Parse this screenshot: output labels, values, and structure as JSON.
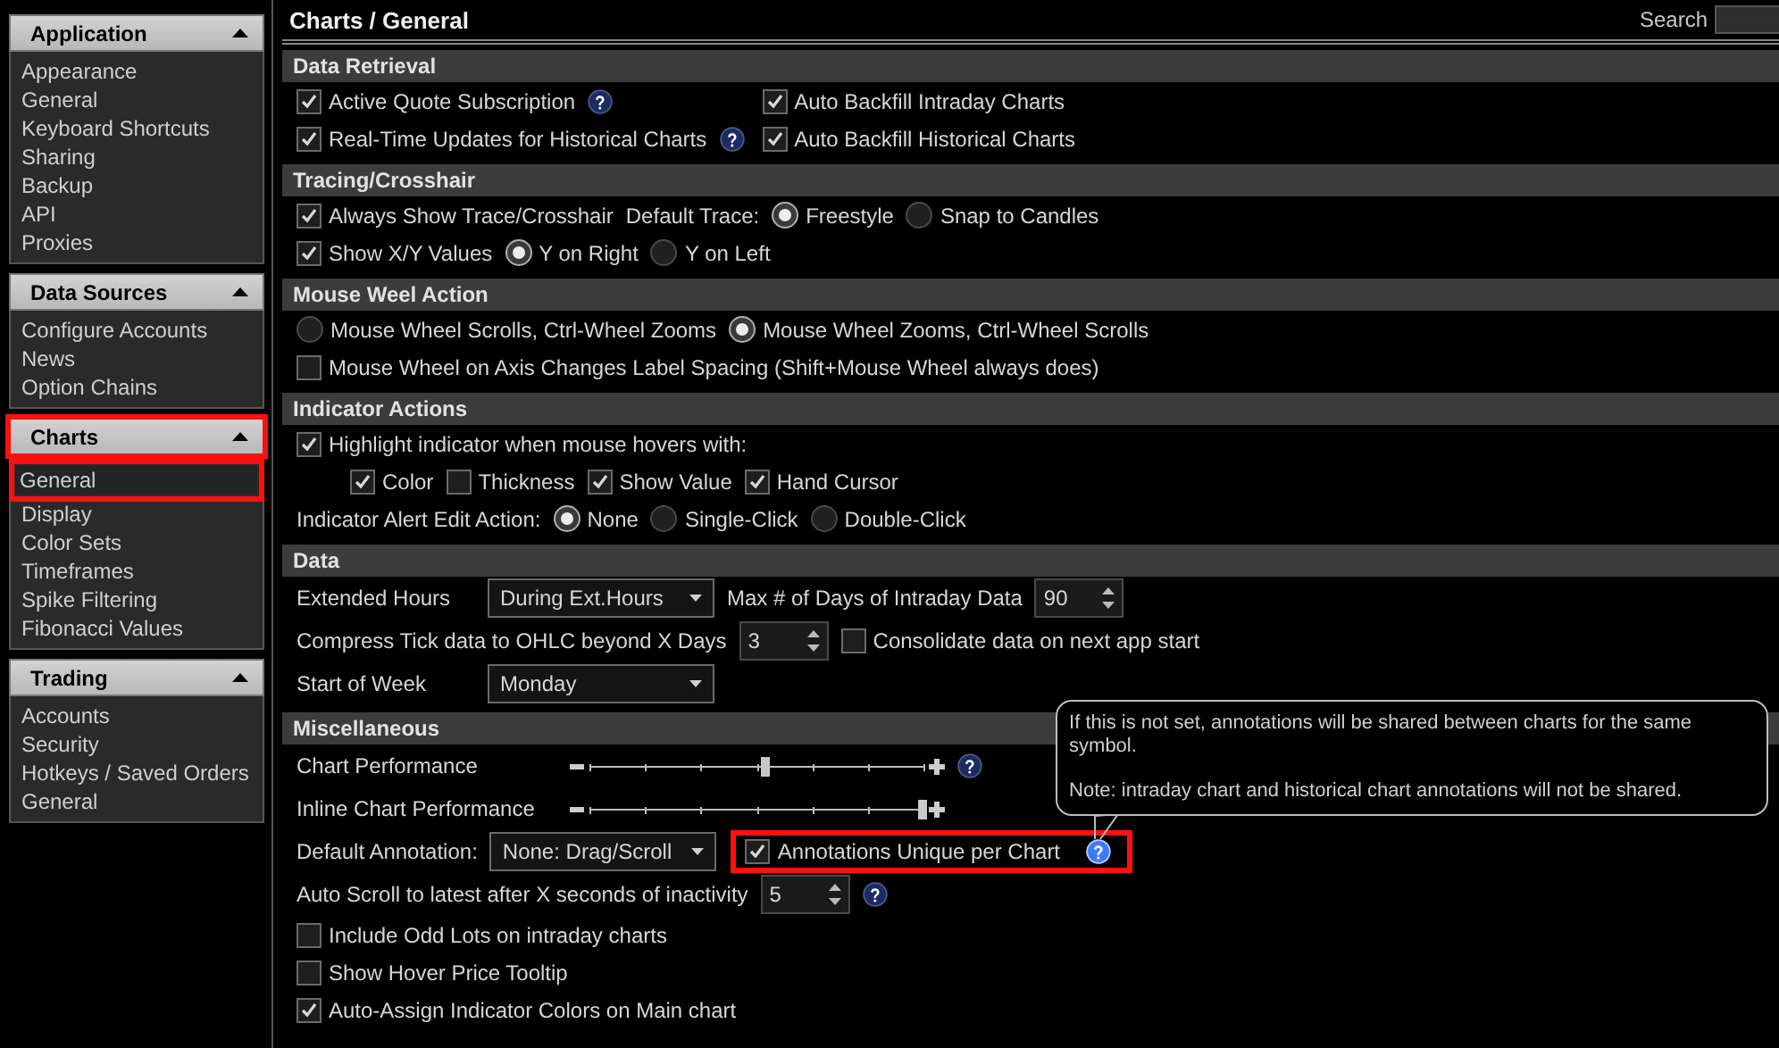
{
  "sidebar": {
    "groups": [
      {
        "title": "Application",
        "expanded": true,
        "highlighted": false,
        "items": [
          {
            "label": "Appearance",
            "selected": false
          },
          {
            "label": "General",
            "selected": false
          },
          {
            "label": "Keyboard Shortcuts",
            "selected": false
          },
          {
            "label": "Sharing",
            "selected": false
          },
          {
            "label": "Backup",
            "selected": false
          },
          {
            "label": "API",
            "selected": false
          },
          {
            "label": "Proxies",
            "selected": false
          }
        ]
      },
      {
        "title": "Data Sources",
        "expanded": true,
        "highlighted": false,
        "items": [
          {
            "label": "Configure Accounts",
            "selected": false
          },
          {
            "label": "News",
            "selected": false
          },
          {
            "label": "Option Chains",
            "selected": false
          }
        ]
      },
      {
        "title": "Charts",
        "expanded": true,
        "highlighted": true,
        "items": [
          {
            "label": "General",
            "selected": true
          },
          {
            "label": "Display",
            "selected": false
          },
          {
            "label": "Color Sets",
            "selected": false
          },
          {
            "label": "Timeframes",
            "selected": false
          },
          {
            "label": "Spike Filtering",
            "selected": false
          },
          {
            "label": "Fibonacci Values",
            "selected": false
          }
        ]
      },
      {
        "title": "Trading",
        "expanded": true,
        "highlighted": false,
        "items": [
          {
            "label": "Accounts",
            "selected": false
          },
          {
            "label": "Security",
            "selected": false
          },
          {
            "label": "Hotkeys / Saved Orders",
            "selected": false
          },
          {
            "label": "General",
            "selected": false
          }
        ]
      }
    ]
  },
  "page_title": "Charts / General",
  "search": {
    "label": "Search"
  },
  "sections": [
    {
      "title": "Data Retrieval",
      "kind": "grid",
      "rows": [
        {
          "cells": [
            [
              {
                "kind": "checkbox",
                "label": "Active Quote Subscription",
                "checked": true
              },
              {
                "kind": "help",
                "hovered": false
              }
            ],
            [
              {
                "kind": "checkbox",
                "label": "Auto Backfill Intraday Charts",
                "checked": true
              }
            ]
          ]
        },
        {
          "cells": [
            [
              {
                "kind": "checkbox",
                "label": "Real-Time Updates for Historical Charts",
                "checked": true
              },
              {
                "kind": "help",
                "hovered": false
              }
            ],
            [
              {
                "kind": "checkbox",
                "label": "Auto Backfill Historical Charts",
                "checked": true
              }
            ]
          ]
        }
      ]
    },
    {
      "title": "Tracing/Crosshair",
      "kind": "flow",
      "rows": [
        {
          "items": [
            {
              "kind": "checkbox",
              "label": "Always Show Trace/Crosshair",
              "checked": true
            },
            {
              "kind": "label",
              "label": "Default Trace:"
            },
            {
              "kind": "radio",
              "label": "Freestyle",
              "selected": true
            },
            {
              "kind": "radio",
              "label": "Snap to Candles",
              "selected": false
            }
          ]
        },
        {
          "items": [
            {
              "kind": "checkbox",
              "label": "Show X/Y Values",
              "checked": true
            },
            {
              "kind": "radio",
              "label": "Y on Right",
              "selected": true
            },
            {
              "kind": "radio",
              "label": "Y on Left",
              "selected": false
            }
          ]
        }
      ]
    },
    {
      "title": "Mouse Weel Action",
      "kind": "flow",
      "rows": [
        {
          "items": [
            {
              "kind": "radio",
              "label": "Mouse Wheel Scrolls, Ctrl-Wheel Zooms",
              "selected": false
            },
            {
              "kind": "radio",
              "label": "Mouse Wheel Zooms, Ctrl-Wheel Scrolls",
              "selected": true
            }
          ]
        },
        {
          "items": [
            {
              "kind": "checkbox",
              "label": "Mouse Wheel on Axis Changes Label Spacing (Shift+Mouse Wheel always does)",
              "checked": false
            }
          ]
        }
      ]
    },
    {
      "title": "Indicator Actions",
      "kind": "flow",
      "rows": [
        {
          "items": [
            {
              "kind": "checkbox",
              "label": "Highlight indicator when mouse hovers with:",
              "checked": true
            }
          ],
          "children": [
            {
              "items": [
                {
                  "kind": "checkbox",
                  "label": "Color",
                  "checked": true
                },
                {
                  "kind": "checkbox",
                  "label": "Thickness",
                  "checked": false
                },
                {
                  "kind": "checkbox",
                  "label": "Show Value",
                  "checked": true
                },
                {
                  "kind": "checkbox",
                  "label": "Hand Cursor",
                  "checked": true
                }
              ]
            }
          ]
        },
        {
          "items": [
            {
              "kind": "label",
              "label": "Indicator Alert Edit Action:"
            },
            {
              "kind": "radio",
              "label": "None",
              "selected": true
            },
            {
              "kind": "radio",
              "label": "Single-Click",
              "selected": false
            },
            {
              "kind": "radio",
              "label": "Double-Click",
              "selected": false
            }
          ]
        }
      ]
    },
    {
      "title": "Data",
      "kind": "flow",
      "rows": [
        {
          "items": [
            {
              "kind": "label",
              "label": "Extended Hours"
            },
            {
              "kind": "dropdown",
              "value": "During Ext.Hours"
            },
            {
              "kind": "label",
              "label": "Max # of Days of Intraday Data"
            },
            {
              "kind": "spinner",
              "value": "90"
            }
          ]
        },
        {
          "items": [
            {
              "kind": "label",
              "label": "Compress Tick data to OHLC beyond X Days"
            },
            {
              "kind": "spinner",
              "value": "3"
            },
            {
              "kind": "checkbox",
              "label": "Consolidate data on next app start",
              "checked": false
            }
          ]
        },
        {
          "items": [
            {
              "kind": "label",
              "label": "Start of Week"
            },
            {
              "kind": "dropdown",
              "value": "Monday"
            }
          ]
        }
      ]
    },
    {
      "title": "Miscellaneous",
      "kind": "flow",
      "rows": [
        {
          "items": [
            {
              "kind": "label",
              "label": "Chart Performance"
            },
            {
              "kind": "slider",
              "level": 0.53
            },
            {
              "kind": "help",
              "hovered": false
            }
          ]
        },
        {
          "items": [
            {
              "kind": "label",
              "label": "Inline Chart Performance"
            },
            {
              "kind": "slider",
              "level": 1.0
            }
          ]
        },
        {
          "items": [
            {
              "kind": "label",
              "label": "Default Annotation:"
            },
            {
              "kind": "dropdown",
              "value": "None: Drag/Scroll"
            },
            {
              "kind": "group",
              "highlighted": true,
              "items": [
                {
                  "kind": "checkbox",
                  "label": "Annotations Unique per Chart",
                  "checked": true
                },
                {
                  "kind": "help",
                  "hovered": true,
                  "tooltip": [
                    "If this is not set, annotations will be shared between charts for the same symbol.",
                    "Note: intraday chart and historical chart annotations will not be shared."
                  ]
                }
              ]
            }
          ]
        },
        {
          "items": [
            {
              "kind": "label",
              "label": "Auto Scroll to latest after X seconds of inactivity"
            },
            {
              "kind": "spinner",
              "value": "5"
            },
            {
              "kind": "help",
              "hovered": false
            }
          ]
        },
        {
          "items": [
            {
              "kind": "checkbox",
              "label": "Include Odd Lots on intraday charts",
              "checked": false
            }
          ]
        },
        {
          "items": [
            {
              "kind": "checkbox",
              "label": "Show Hover Price Tooltip",
              "checked": false
            }
          ]
        },
        {
          "items": [
            {
              "kind": "checkbox",
              "label": "Auto-Assign Indicator Colors on Main chart",
              "checked": true
            }
          ]
        }
      ]
    }
  ]
}
